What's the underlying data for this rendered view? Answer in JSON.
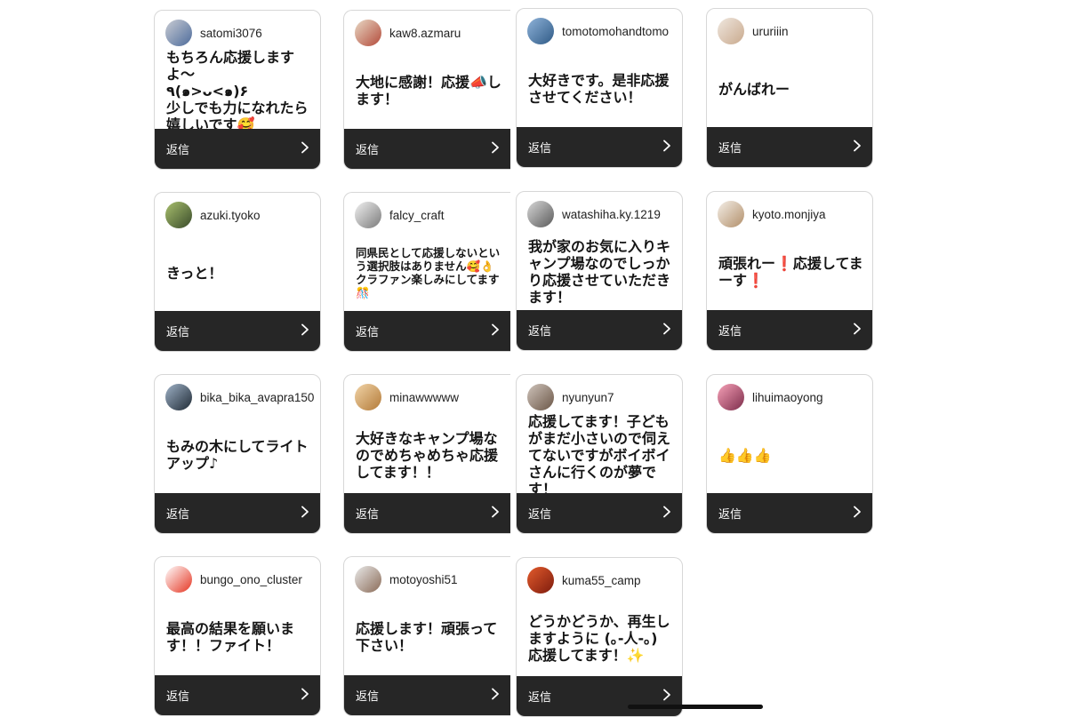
{
  "reply_label": "返信",
  "cards": [
    {
      "username": "satomi3076",
      "message": "もちろん応援しますよ〜\n٩(๑>ᴗ<๑)۶\n少しでも力になれたら嬉しいです🥰",
      "avatar_colors": [
        "#c9ccd3",
        "#4d6b9b"
      ]
    },
    {
      "username": "kaw8.azmaru",
      "message": "大地に感謝！応援📣します！",
      "avatar_colors": [
        "#e8d9c5",
        "#b34a3a"
      ]
    },
    {
      "username": "tomotomohandtomo",
      "message": "大好きです。是非応援させてください！",
      "avatar_colors": [
        "#8fb3d9",
        "#2f5a86"
      ]
    },
    {
      "username": "ururiiin",
      "message": "がんばれー",
      "avatar_colors": [
        "#efe7df",
        "#c9a98d"
      ]
    },
    {
      "username": "azuki.tyoko",
      "message": "きっと！",
      "avatar_colors": [
        "#a9c06e",
        "#394b2a"
      ]
    },
    {
      "username": "falcy_craft",
      "message": "同県民として応援しないという選択肢はありません🥰👌クラファン楽しみにしてます🎊",
      "avatar_colors": [
        "#f1f1f1",
        "#7a7a7a"
      ]
    },
    {
      "username": "watashiha.ky.1219",
      "message": "我が家のお気に入りキャンプ場なのでしっかり応援させていただきます！",
      "avatar_colors": [
        "#d8d8d8",
        "#5a5a5a"
      ]
    },
    {
      "username": "kyoto.monjiya",
      "message": "頑張れー❗️応援してまーす❗️",
      "avatar_colors": [
        "#f4efe8",
        "#b28f6a"
      ]
    },
    {
      "username": "bika_bika_avapra150",
      "message": "もみの木にしてライトアップ♪",
      "avatar_colors": [
        "#9fb2c7",
        "#1f2a35"
      ]
    },
    {
      "username": "minawwwww",
      "message": "大好きなキャンプ場なのでめちゃめちゃ応援してます！！",
      "avatar_colors": [
        "#f1d4a8",
        "#b37a38"
      ]
    },
    {
      "username": "nyunyun7",
      "message": "応援してます！子どもがまだ小さいので伺えてないですがボイボイさんに行くのが夢です！",
      "avatar_colors": [
        "#cfc4bc",
        "#6b5646"
      ]
    },
    {
      "username": "lihuimaoyong",
      "message": "👍👍👍",
      "avatar_colors": [
        "#f7a1b8",
        "#7c2c4a"
      ]
    },
    {
      "username": "bungo_ono_cluster",
      "message": "最高の結果を願います！！ファイト！",
      "avatar_colors": [
        "#ffffff",
        "#e53522"
      ]
    },
    {
      "username": "motoyoshi51",
      "message": "応援します！頑張って下さい！",
      "avatar_colors": [
        "#e9e9e9",
        "#8a6b57"
      ]
    },
    {
      "username": "kuma55_camp",
      "message": "どうかどうか、再生しますように (｡-人-｡) 応援してます！✨",
      "avatar_colors": [
        "#e35b2c",
        "#7d1b0d"
      ]
    }
  ]
}
